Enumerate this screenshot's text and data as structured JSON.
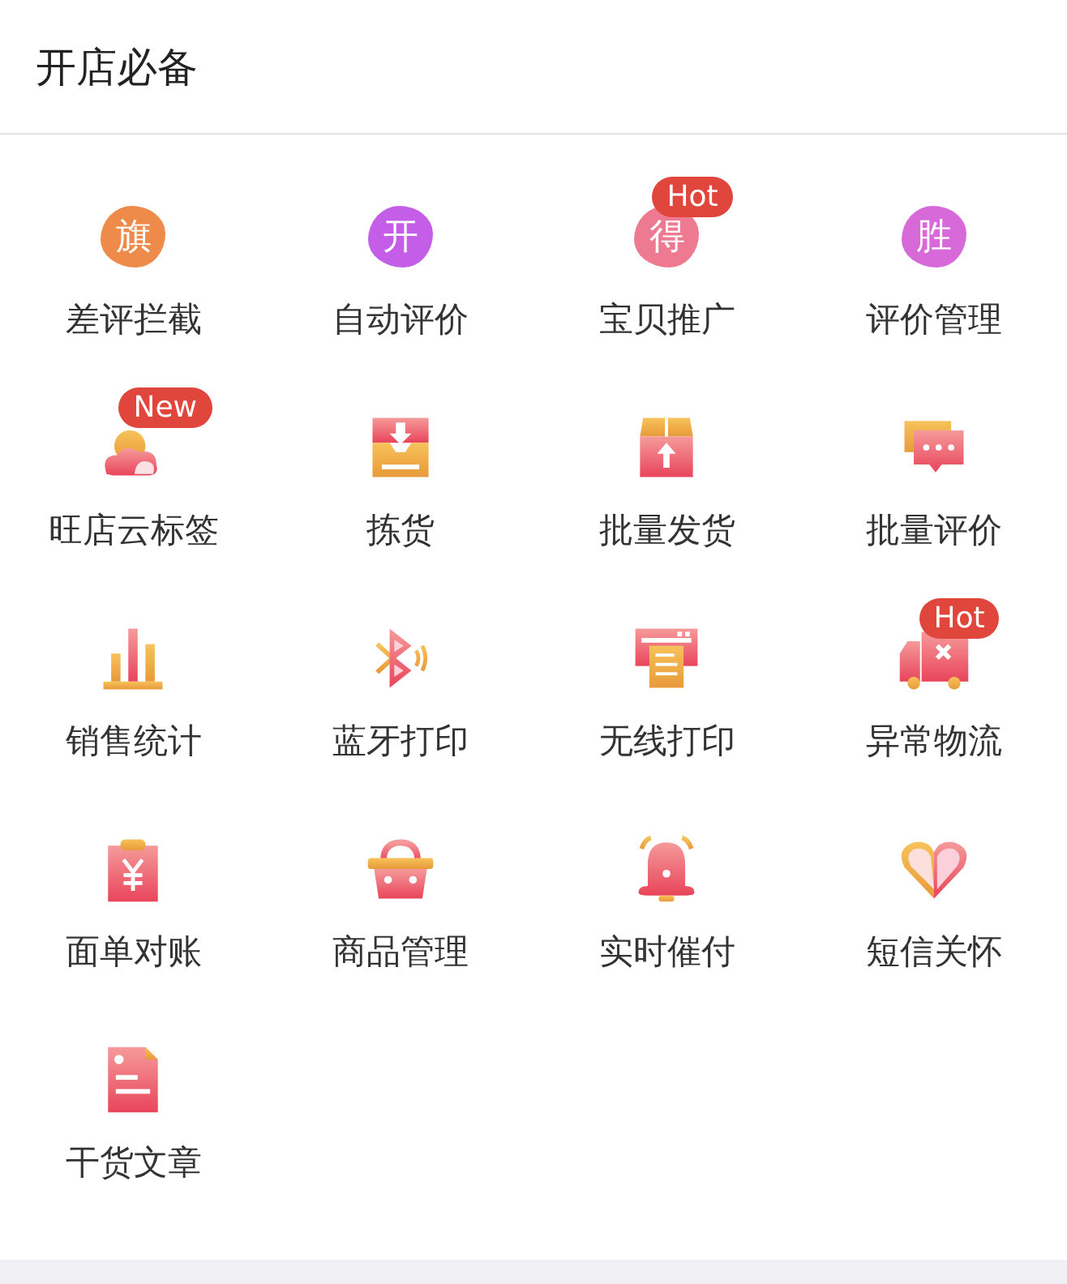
{
  "header": {
    "title": "开店必备"
  },
  "items": [
    {
      "label": "差评拦截",
      "kind": "blob",
      "glyph": "旗",
      "color": "#ee8a4a"
    },
    {
      "label": "自动评价",
      "kind": "blob",
      "glyph": "开",
      "color": "#c45ee8"
    },
    {
      "label": "宝贝推广",
      "kind": "blob",
      "glyph": "得",
      "color": "#ee7a92",
      "badge": "Hot"
    },
    {
      "label": "评价管理",
      "kind": "blob",
      "glyph": "胜",
      "color": "#d76ad8"
    },
    {
      "label": "旺店云标签",
      "kind": "cloud",
      "badge": "New"
    },
    {
      "label": "拣货",
      "kind": "inbox"
    },
    {
      "label": "批量发货",
      "kind": "box"
    },
    {
      "label": "批量评价",
      "kind": "chat"
    },
    {
      "label": "销售统计",
      "kind": "bars"
    },
    {
      "label": "蓝牙打印",
      "kind": "bluetooth"
    },
    {
      "label": "无线打印",
      "kind": "printer"
    },
    {
      "label": "异常物流",
      "kind": "truck",
      "badge": "Hot"
    },
    {
      "label": "面单对账",
      "kind": "clipboard"
    },
    {
      "label": "商品管理",
      "kind": "basket"
    },
    {
      "label": "实时催付",
      "kind": "bell"
    },
    {
      "label": "短信关怀",
      "kind": "heart"
    },
    {
      "label": "干货文章",
      "kind": "doc"
    }
  ]
}
